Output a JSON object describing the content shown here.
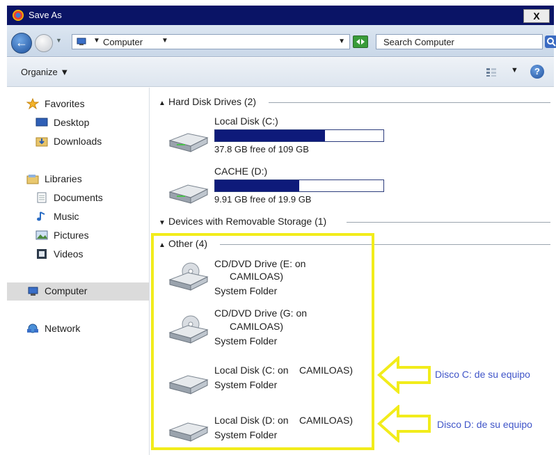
{
  "window": {
    "title": "Save As",
    "close_label": "X"
  },
  "address": {
    "location": "Computer",
    "search_placeholder": "Search Computer"
  },
  "toolbar": {
    "organize_label": "Organize"
  },
  "sidebar": {
    "favorites": {
      "label": "Favorites",
      "items": [
        {
          "label": "Desktop"
        },
        {
          "label": "Downloads"
        }
      ]
    },
    "libraries": {
      "label": "Libraries",
      "items": [
        {
          "label": "Documents"
        },
        {
          "label": "Music"
        },
        {
          "label": "Pictures"
        },
        {
          "label": "Videos"
        }
      ]
    },
    "computer_label": "Computer",
    "network_label": "Network"
  },
  "content": {
    "groups": {
      "hard_disks": "Hard Disk Drives (2)",
      "removable": "Devices with Removable Storage (1)",
      "other": "Other (4)"
    },
    "hard_disks": [
      {
        "name": "Local Disk (C:)",
        "free_text": "37.8 GB free of 109 GB",
        "used_fraction": 0.653
      },
      {
        "name": "CACHE (D:)",
        "free_text": "9.91 GB free of 19.9 GB",
        "used_fraction": 0.502
      }
    ],
    "other_items": [
      {
        "line1": "CD/DVD Drive (E: on",
        "line2": "CAMILOAS)",
        "sub": "System Folder",
        "type": "dvd"
      },
      {
        "line1": "CD/DVD Drive (G: on",
        "line2": "CAMILOAS)",
        "sub": "System Folder",
        "type": "dvd"
      },
      {
        "line1": "Local Disk (C: on",
        "line2": "CAMILOAS)",
        "sub": "System Folder",
        "type": "disk"
      },
      {
        "line1": "Local Disk (D: on",
        "line2": "CAMILOAS)",
        "sub": "System Folder",
        "type": "disk"
      }
    ]
  },
  "annotations": [
    {
      "text": "Disco C: de su equipo"
    },
    {
      "text": "Disco D: de su equipo"
    }
  ],
  "colors": {
    "title_bar": "#0a1466",
    "drive_bar_fill": "#0e1a7a",
    "highlight": "#f2ec1b",
    "annotation_text": "#3f54c8"
  }
}
